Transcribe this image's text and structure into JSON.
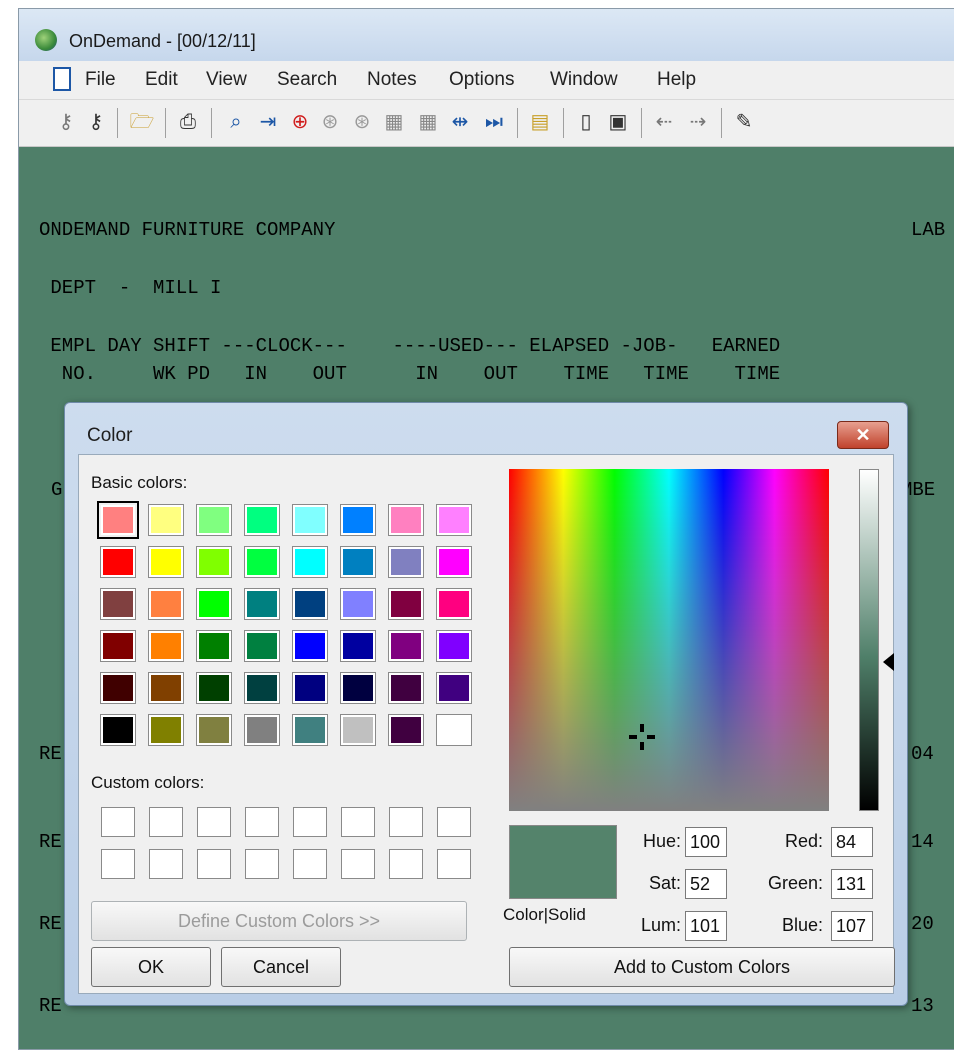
{
  "window": {
    "title": "OnDemand - [00/12/11]"
  },
  "menu": [
    "File",
    "Edit",
    "View",
    "Search",
    "Notes",
    "Options",
    "Window",
    "Help"
  ],
  "report": {
    "lines": [
      "ONDEMAND FURNITURE COMPANY",
      " DEPT  -  MILL I",
      " EMPL DAY SHIFT ---CLOCK---    ----USED--- ELAPSED -JOB-   EARNED",
      "  NO.     WK PD   IN    OUT      IN    OUT    TIME   TIME    TIME"
    ],
    "right_fragment_1": "LAB",
    "left_fragment_g": "G",
    "right_fragment_mbe": "MBE",
    "left_re": "RE",
    "right_04": "04",
    "right_14": "14",
    "right_20": "20",
    "right_13": "13"
  },
  "dialog": {
    "title": "Color",
    "close_label": "✕",
    "basic_colors_label": "Basic colors:",
    "custom_colors_label": "Custom colors:",
    "define_custom_label": "Define Custom Colors >>",
    "ok_label": "OK",
    "cancel_label": "Cancel",
    "add_custom_label": "Add to Custom Colors",
    "color_solid_label": "Color|Solid",
    "fields": {
      "hue_label": "Hue:",
      "hue": "100",
      "sat_label": "Sat:",
      "sat": "52",
      "lum_label": "Lum:",
      "lum": "101",
      "red_label": "Red:",
      "red": "84",
      "green_label": "Green:",
      "green": "131",
      "blue_label": "Blue:",
      "blue": "107"
    },
    "basic_colors": [
      [
        "#ff8080",
        "#ffff80",
        "#80ff80",
        "#00ff80",
        "#80ffff",
        "#0080ff",
        "#ff80c0",
        "#ff80ff"
      ],
      [
        "#ff0000",
        "#ffff00",
        "#80ff00",
        "#00ff40",
        "#00ffff",
        "#0080c0",
        "#8080c0",
        "#ff00ff"
      ],
      [
        "#804040",
        "#ff8040",
        "#00ff00",
        "#008080",
        "#004080",
        "#8080ff",
        "#800040",
        "#ff0080"
      ],
      [
        "#800000",
        "#ff8000",
        "#008000",
        "#008040",
        "#0000ff",
        "#0000a0",
        "#800080",
        "#8000ff"
      ],
      [
        "#400000",
        "#804000",
        "#004000",
        "#004040",
        "#000080",
        "#000040",
        "#400040",
        "#400080"
      ],
      [
        "#000000",
        "#808000",
        "#808040",
        "#808080",
        "#408080",
        "#c0c0c0",
        "#400040",
        "#ffffff"
      ]
    ],
    "selected_color": "#54836b",
    "background_color": "#4f7f69"
  }
}
